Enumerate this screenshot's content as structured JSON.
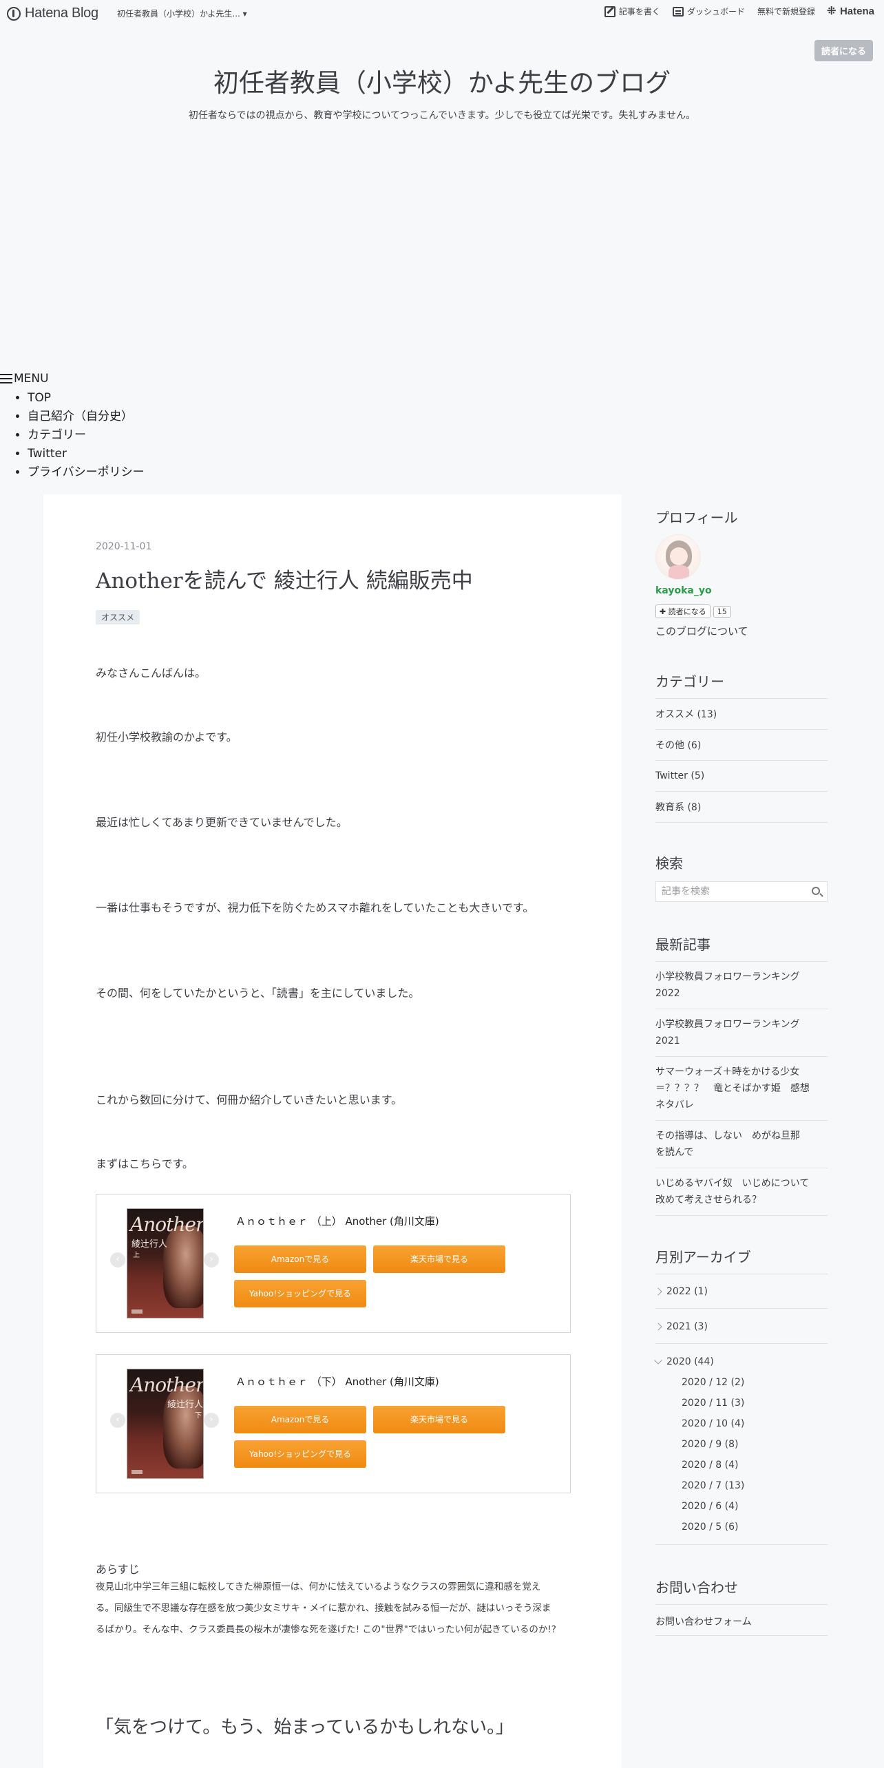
{
  "header": {
    "brand": "Hatena Blog",
    "blog_name": "初任者教員（小学校）かよ先生... ▾",
    "write_label": "記事を書く",
    "dashboard_label": "ダッシュボード",
    "signup_label": "無料で新規登録",
    "hatena_label": "Hatena",
    "reader_button": "読者になる"
  },
  "blog": {
    "title": "初任者教員（小学校）かよ先生のブログ",
    "description": "初任者ならではの視点から、教育や学校についてつっこんでいきます。少しでも役立てば光栄です。失礼すみません。"
  },
  "menu": {
    "label": "MENU",
    "items": [
      "TOP",
      "自己紹介（自分史）",
      "カテゴリー",
      "Twitter",
      "プライバシーポリシー"
    ]
  },
  "entry": {
    "date": "2020-11-01",
    "title": "Anotherを読んで 綾辻行人 続編販売中",
    "category": "オススメ",
    "paragraphs": [
      "みなさんこんばんは。",
      "初任小学校教諭のかよです。",
      "最近は忙しくてあまり更新できていませんでした。",
      "一番は仕事もそうですが、視力低下を防ぐためスマホ離れをしていたことも大きいです。",
      "その間、何をしていたかというと、「読書」を主にしていました。",
      "これから数回に分けて、何冊か紹介していきたいと思います。",
      "まずはこちらです。"
    ],
    "products": [
      {
        "cover_title": "Another",
        "cover_author": "綾辻行人",
        "cover_vol": "上",
        "name": "Ａｎｏｔｈｅｒ （上） Another (角川文庫)",
        "amazon": "Amazonで見る",
        "rakuten": "楽天市場で見る",
        "yahoo": "Yahoo!ショッピングで見る"
      },
      {
        "cover_title": "Another",
        "cover_author": "綾辻行人",
        "cover_vol": "下",
        "name": "Ａｎｏｔｈｅｒ （下） Another (角川文庫)",
        "amazon": "Amazonで見る",
        "rakuten": "楽天市場で見る",
        "yahoo": "Yahoo!ショッピングで見る"
      }
    ],
    "summary_heading": "あらすじ",
    "summary_lines": [
      "夜見山北中学三年三組に転校してきた榊原恒一は、何かに怯えているようなクラスの雰囲気に違和感を覚え",
      "る。同級生で不思議な存在感を放つ美少女ミサキ・メイに惹かれ、接触を試みる恒一だが、謎はいっそう深ま",
      "るばかり。そんな中、クラス委員長の桜木が凄惨な死を遂げた! この\"世界\"ではいったい何が起きているのか!?"
    ],
    "quote": "「気をつけて。もう、始まっているかもしれない。」"
  },
  "sidebar": {
    "profile": {
      "heading": "プロフィール",
      "username": "kayoka_yo",
      "subscribe_label": "読者になる",
      "subscriber_count": "15",
      "about": "このブログについて"
    },
    "categories": {
      "heading": "カテゴリー",
      "items": [
        "オススメ (13)",
        "その他 (6)",
        "Twitter (5)",
        "教育系 (8)"
      ]
    },
    "search": {
      "heading": "検索",
      "placeholder": "記事を検索"
    },
    "recent": {
      "heading": "最新記事",
      "items": [
        [
          "小学校教員フォロワーランキング",
          "2022"
        ],
        [
          "小学校教員フォロワーランキング",
          "2021"
        ],
        [
          "サマーウォーズ＋時をかける少女",
          "＝？？？？　竜とそばかす姫　感想",
          "ネタバレ"
        ],
        [
          "その指導は、しない　めがね旦那",
          "を読んで"
        ],
        [
          "いじめるヤバイ奴　いじめについて",
          "改めて考えさせられる？"
        ]
      ]
    },
    "archive": {
      "heading": "月別アーカイブ",
      "years": [
        "2022 (1)",
        "2021 (3)",
        "2020 (44)"
      ],
      "months_2020": [
        "2020 / 12 (2)",
        "2020 / 11 (3)",
        "2020 / 10 (4)",
        "2020 / 9 (8)",
        "2020 / 8 (4)",
        "2020 / 7 (13)",
        "2020 / 6 (4)",
        "2020 / 5 (6)"
      ]
    },
    "contact": {
      "heading": "お問い合わせ",
      "link": "お問い合わせフォーム"
    }
  }
}
